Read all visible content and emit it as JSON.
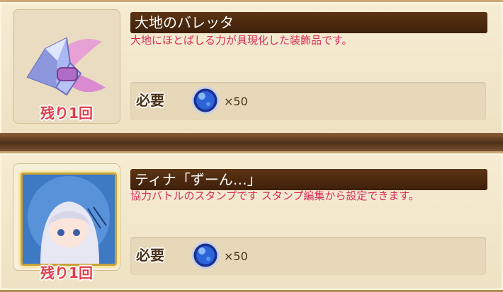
{
  "items": [
    {
      "title": "大地のバレッタ",
      "description": "大地にほとばしる力が具現化した装飾品です。",
      "remaining": "残り1回",
      "requirement_label": "必要",
      "quantity": "×50",
      "item_icon": "crystal-barrette-icon",
      "cost_icon": "blue-orb-icon"
    },
    {
      "title": "ティナ「ずーん…」",
      "description": "協力バトルのスタンプです スタンプ編集から設定できます。",
      "remaining": "残り1回",
      "requirement_label": "必要",
      "quantity": "×50",
      "item_icon": "tina-stamp-icon",
      "stamp_text": "ずーん…",
      "cost_icon": "blue-orb-icon"
    }
  ],
  "colors": {
    "title_bar": "#4a2710",
    "description_text": "#d62c5a",
    "remaining_text": "#e23b49",
    "card_background": "#f3e8cc"
  }
}
